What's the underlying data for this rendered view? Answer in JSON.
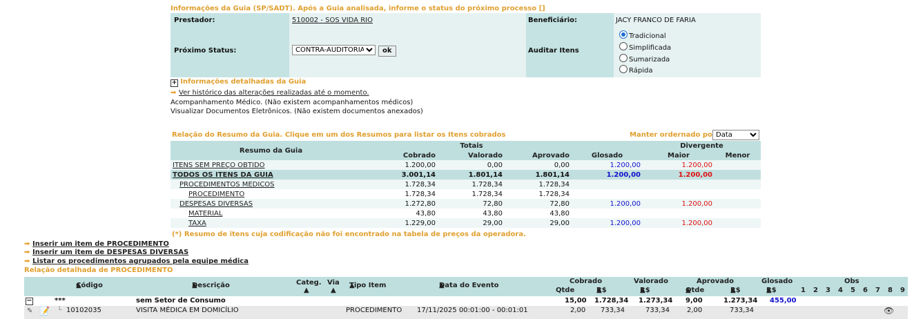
{
  "info": {
    "title": "Informações da Guia (SP/SADT). Após a Guia analisada, informe o status do próximo processo []",
    "prestador_label": "Prestador:",
    "prestador_value": "510002 - SOS VIDA RIO",
    "beneficiario_label": "Beneficiário:",
    "beneficiario_value": "JACY FRANCO DE FARIA",
    "proximo_status_label": "Próximo Status:",
    "proximo_status_value": "CONTRA-AUDITORIA",
    "ok_label": "ok",
    "auditar_label": "Auditar Itens",
    "radios": [
      "Tradicional",
      "Simplificada",
      "Sumarizada",
      "Rápida"
    ],
    "detalhadas": "Informações detalhadas da Guia",
    "historico": "Ver histórico das alterações realizadas até o momento.",
    "acompanhamento": "Acompanhamento Médico. (Não existem acompanhamentos médicos)",
    "documentos": "Visualizar Documentos Eletrônicos. (Não existem documentos anexados)"
  },
  "resumo": {
    "title": "Relação do Resumo da Guia. Clique em um dos Resumos para listar os Itens cobrados",
    "manter_label": "Manter ordernado por",
    "manter_value": "Data",
    "headers": {
      "resumo": "Resumo da Guia",
      "totais": "Totais",
      "divergente": "Divergente",
      "cobrado": "Cobrado",
      "valorado": "Valorado",
      "aprovado": "Aprovado",
      "glosado": "Glosado",
      "maior": "Maior",
      "menor": "Menor"
    },
    "rows": [
      {
        "name": "ITENS SEM PREÇO OBTIDO",
        "cobrado": "1.200,00",
        "valorado": "0,00",
        "aprovado": "0,00",
        "glosado": "1.200,00",
        "maior": "1.200,00"
      },
      {
        "name": "TODOS OS ITENS DA GUIA",
        "cobrado": "3.001,14",
        "valorado": "1.801,14",
        "aprovado": "1.801,14",
        "glosado": "1.200,00",
        "maior": "1.200,00"
      },
      {
        "name": "PROCEDIMENTOS MEDICOS",
        "cobrado": "1.728,34",
        "valorado": "1.728,34",
        "aprovado": "1.728,34",
        "glosado": "",
        "maior": ""
      },
      {
        "name": "PROCEDIMENTO",
        "cobrado": "1.728,34",
        "valorado": "1.728,34",
        "aprovado": "1.728,34",
        "glosado": "",
        "maior": ""
      },
      {
        "name": "DESPESAS DIVERSAS",
        "cobrado": "1.272,80",
        "valorado": "72,80",
        "aprovado": "72,80",
        "glosado": "1.200,00",
        "maior": "1.200,00"
      },
      {
        "name": "MATERIAL",
        "cobrado": "43,80",
        "valorado": "43,80",
        "aprovado": "43,80",
        "glosado": "",
        "maior": ""
      },
      {
        "name": "TAXA",
        "cobrado": "1.229,00",
        "valorado": "29,00",
        "aprovado": "29,00",
        "glosado": "1.200,00",
        "maior": "1.200,00"
      }
    ],
    "note": "(*) Resumo de itens cuja codificação não foi encontrado na tabela de preços da operadora."
  },
  "actions": {
    "inserir_proc": "Inserir um item de PROCEDIMENTO",
    "inserir_desp": "Inserir um item de DESPESAS DIVERSAS",
    "listar": "Listar os procedimentos agrupados pela equipe médica",
    "relacao": "Relação detalhada de PROCEDIMENTO"
  },
  "detalhe": {
    "headers": {
      "codigo": "Código",
      "descricao": "Descrição",
      "categ": "Categ.",
      "via": "Via",
      "tipo": "Tipo Item",
      "data": "Data do Evento",
      "cobrado": "Cobrado",
      "valorado": "Valorado",
      "aprovado": "Aprovado",
      "glosado": "Glosado",
      "obs": "Obs",
      "qtde": "Qtde",
      "rs": "R$"
    },
    "obs_cols": [
      "1",
      "2",
      "3",
      "4",
      "5",
      "6",
      "7",
      "8",
      "9"
    ],
    "group": {
      "code": "***",
      "desc": "sem Setor de Consumo",
      "cob_qtde": "15,00",
      "cob_rs": "1.728,34",
      "val_rs": "1.273,34",
      "apr_qtde": "9,00",
      "apr_rs": "1.273,34",
      "glosado": "455,00"
    },
    "item": {
      "code": "10102035",
      "desc": "VISITA MÉDICA EM DOMICÍLIO",
      "tipo": "PROCEDIMENTO",
      "data": "17/11/2025 00:01:00 - 00:01:01",
      "cob_qtde": "2,00",
      "cob_rs": "733,34",
      "val_rs": "733,34",
      "apr_qtde": "2,00",
      "apr_rs": "733,34"
    }
  }
}
